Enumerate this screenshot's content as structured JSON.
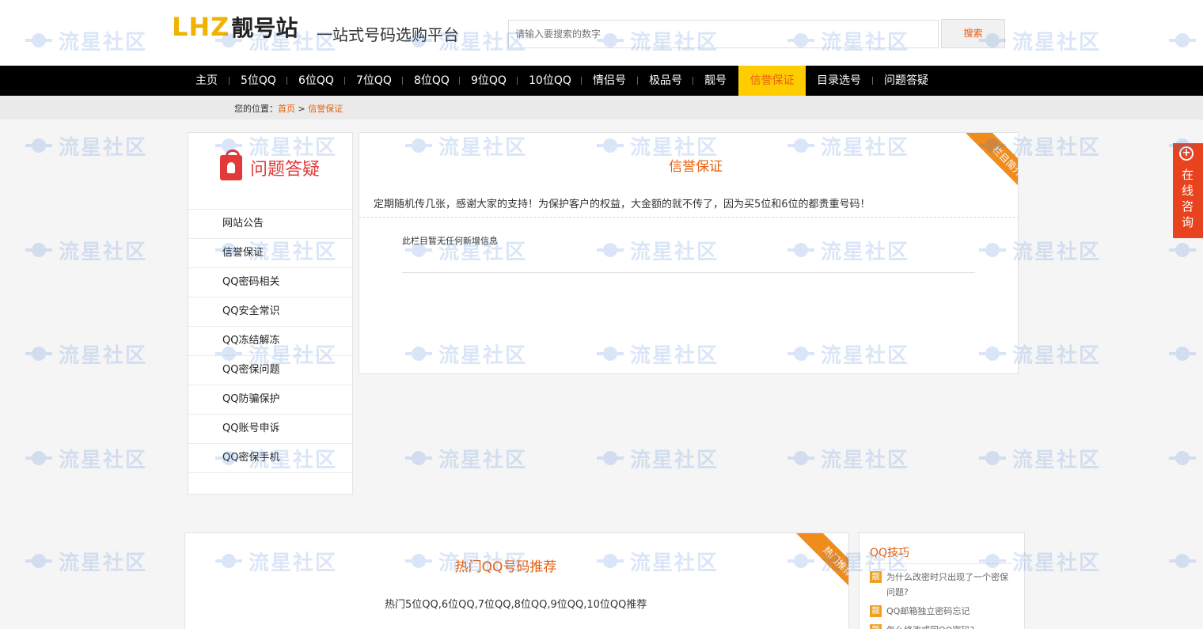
{
  "header": {
    "logo_mark": "LHZ",
    "logo_cn": "靓号站",
    "slogan": "一站式号码选购平台",
    "search_placeholder": "请输入要搜索的数字",
    "search_button": "搜索"
  },
  "nav": {
    "items": [
      "主页",
      "5位QQ",
      "6位QQ",
      "7位QQ",
      "8位QQ",
      "9位QQ",
      "10位QQ",
      "情侣号",
      "极品号",
      "靓号",
      "信誉保证",
      "目录选号",
      "问题答疑"
    ],
    "active": "信誉保证"
  },
  "breadcrumb": {
    "prefix": "您的位置：",
    "home": "首页",
    "sep": ">",
    "current": "信誉保证"
  },
  "sidebar": {
    "title": "问题答疑",
    "items": [
      "网站公告",
      "信誉保证",
      "QQ密码相关",
      "QQ安全常识",
      "QQ冻结解冻",
      "QQ密保问题",
      "QQ防骗保护",
      "QQ账号申诉",
      "QQ密保手机"
    ]
  },
  "main": {
    "title": "信誉保证",
    "ribbon": "栏目简介",
    "description": "定期随机传几张，感谢大家的支持！为保护客户的权益，大金额的就不传了，因为买5位和6位的都贵重号码！",
    "empty_text": "此栏目暂无任何新增信息"
  },
  "hot": {
    "title": "热门QQ号码推荐",
    "ribbon": "热门推荐",
    "description": "热门5位QQ,6位QQ,7位QQ,8位QQ,9位QQ,10位QQ推荐"
  },
  "tips": {
    "title": "QQ技巧",
    "icon_char": "靓",
    "items": [
      "为什么改密时只出现了一个密保问题?",
      "QQ邮箱独立密码忘记",
      "怎么修改或回QQ密码?"
    ]
  },
  "consult": {
    "plus": "+",
    "text": "在线咨询"
  },
  "watermark": {
    "text": "流星社区"
  },
  "colors": {
    "accent": "#e8600d",
    "nav_bg": "#000000",
    "nav_active_bg": "#ffcc00",
    "ribbon": "#f08b1d",
    "consult_bg": "#e8431e"
  }
}
